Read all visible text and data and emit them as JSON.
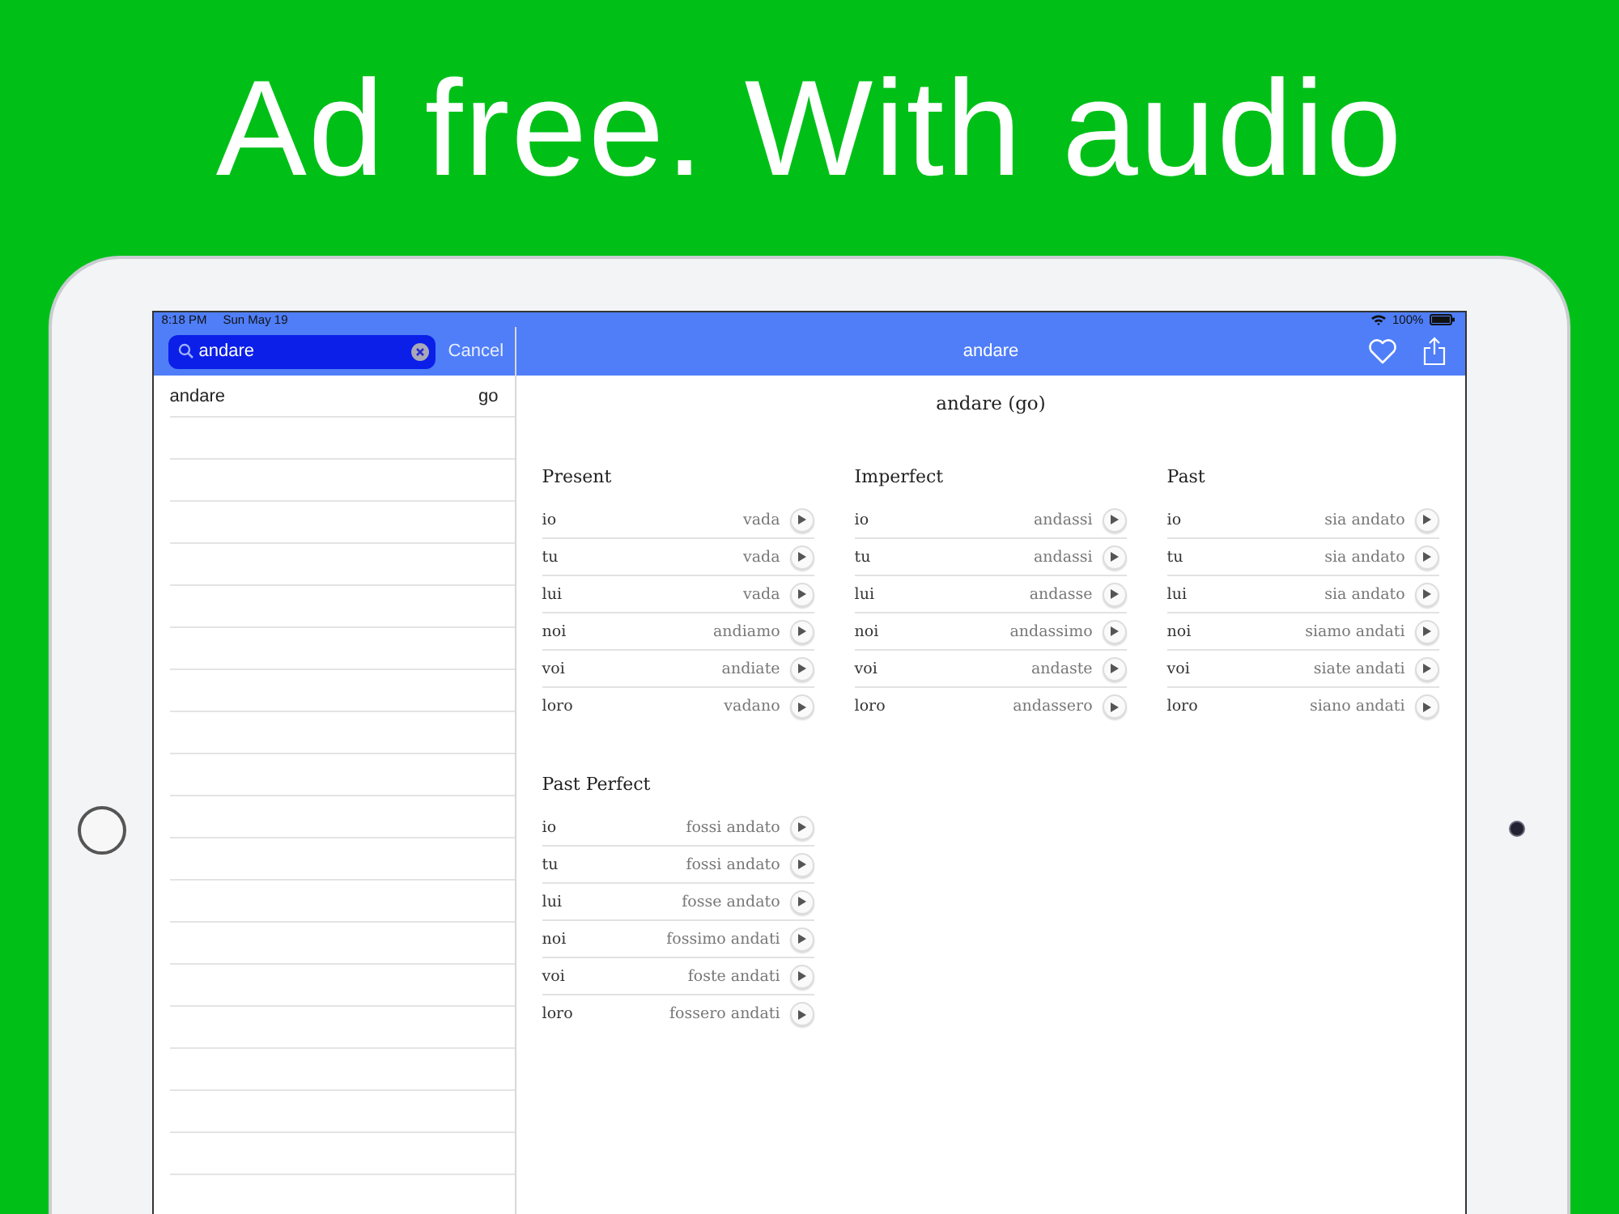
{
  "headline": "Ad free. With audio",
  "status_bar": {
    "time": "8:18 PM",
    "date": "Sun May 19",
    "battery": "100%"
  },
  "search": {
    "value": "andare",
    "cancel": "Cancel"
  },
  "results": [
    {
      "word": "andare",
      "translation": "go"
    }
  ],
  "nav": {
    "title": "andare",
    "favorite": false
  },
  "heading": "andare (go)",
  "tenses": [
    {
      "name": "Present",
      "forms": [
        {
          "pronoun": "io",
          "form": "vada"
        },
        {
          "pronoun": "tu",
          "form": "vada"
        },
        {
          "pronoun": "lui",
          "form": "vada"
        },
        {
          "pronoun": "noi",
          "form": "andiamo"
        },
        {
          "pronoun": "voi",
          "form": "andiate"
        },
        {
          "pronoun": "loro",
          "form": "vadano"
        }
      ]
    },
    {
      "name": "Imperfect",
      "forms": [
        {
          "pronoun": "io",
          "form": "andassi"
        },
        {
          "pronoun": "tu",
          "form": "andassi"
        },
        {
          "pronoun": "lui",
          "form": "andasse"
        },
        {
          "pronoun": "noi",
          "form": "andassimo"
        },
        {
          "pronoun": "voi",
          "form": "andaste"
        },
        {
          "pronoun": "loro",
          "form": "andassero"
        }
      ]
    },
    {
      "name": "Past",
      "forms": [
        {
          "pronoun": "io",
          "form": "sia andato"
        },
        {
          "pronoun": "tu",
          "form": "sia andato"
        },
        {
          "pronoun": "lui",
          "form": "sia andato"
        },
        {
          "pronoun": "noi",
          "form": "siamo andati"
        },
        {
          "pronoun": "voi",
          "form": "siate andati"
        },
        {
          "pronoun": "loro",
          "form": "siano andati"
        }
      ]
    },
    {
      "name": "Past Perfect",
      "forms": [
        {
          "pronoun": "io",
          "form": "fossi andato"
        },
        {
          "pronoun": "tu",
          "form": "fossi andato"
        },
        {
          "pronoun": "lui",
          "form": "fosse andato"
        },
        {
          "pronoun": "noi",
          "form": "fossimo andati"
        },
        {
          "pronoun": "voi",
          "form": "foste andati"
        },
        {
          "pronoun": "loro",
          "form": "fossero andati"
        }
      ]
    }
  ]
}
